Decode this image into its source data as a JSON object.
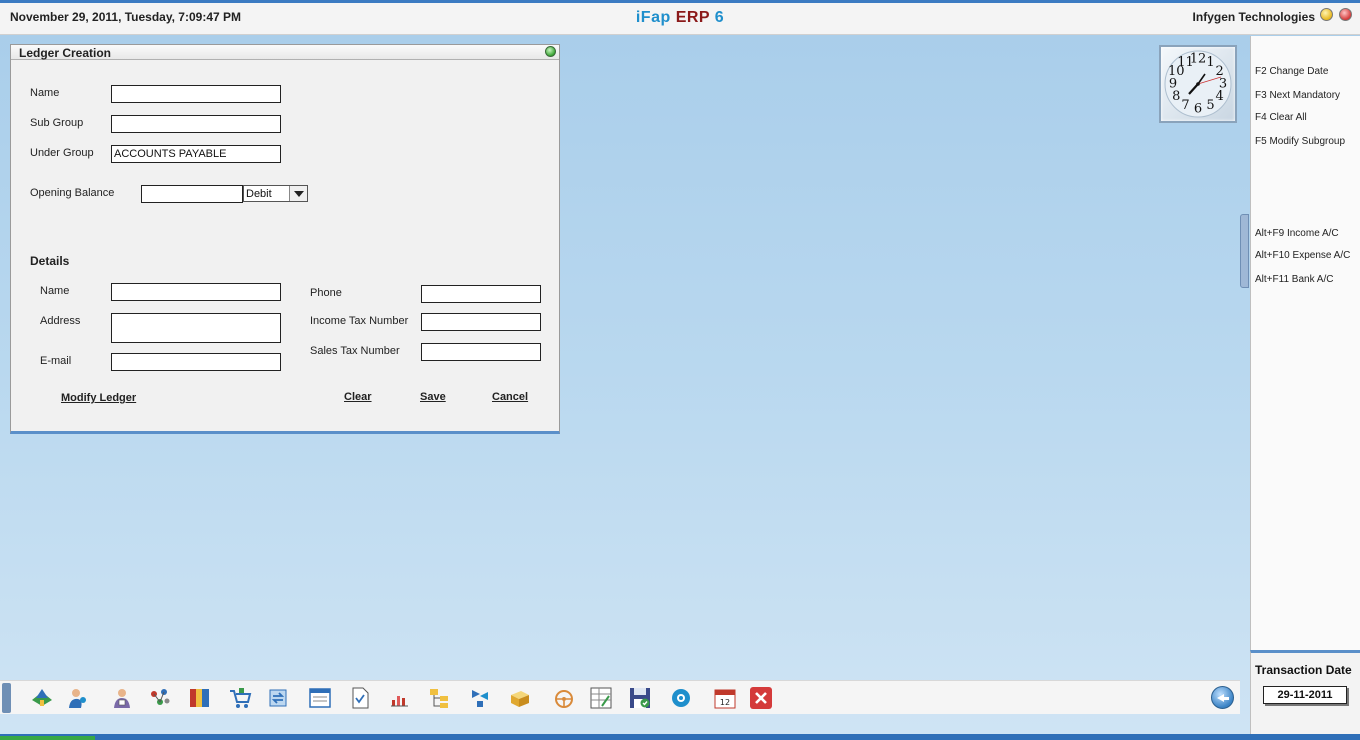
{
  "header": {
    "datetime": "November  29, 2011, Tuesday, 7:09:47 PM",
    "brand_part1": "iFap",
    "brand_part2": "ERP",
    "brand_part3": "6",
    "company": "Infygen Technologies"
  },
  "ledger": {
    "title": "Ledger Creation",
    "name_label": "Name",
    "name_value": "",
    "subgroup_label": "Sub Group",
    "subgroup_value": "",
    "undergroup_label": "Under Group",
    "undergroup_value": "ACCOUNTS PAYABLE",
    "opening_balance_label": "Opening Balance",
    "opening_balance_value": "",
    "balance_type": "Debit",
    "details_heading": "Details",
    "details_name_label": "Name",
    "details_name_value": "",
    "address_label": "Address",
    "address_value": "",
    "email_label": "E-mail",
    "email_value": "",
    "phone_label": "Phone",
    "phone_value": "",
    "income_tax_label": "Income Tax Number",
    "income_tax_value": "",
    "sales_tax_label": "Sales Tax Number",
    "sales_tax_value": "",
    "modify_button": "Modify Ledger",
    "clear_button": "Clear",
    "save_button": "Save",
    "cancel_button": "Cancel"
  },
  "shortcuts": [
    "F2 Change Date",
    "F3 Next Mandatory",
    "F4 Clear All",
    "F5 Modify Subgroup",
    "Alt+F9 Income A/C",
    "Alt+F10 Expense A/C",
    "Alt+F11 Bank A/C"
  ],
  "transaction": {
    "label": "Transaction Date",
    "date": "29-11-2011"
  },
  "clock": {
    "numerals": [
      "12",
      "1",
      "2",
      "3",
      "4",
      "5",
      "6",
      "7",
      "8",
      "9",
      "10",
      "11"
    ],
    "time": "7:09:47"
  },
  "toolbar": {
    "icons": [
      "company-icon",
      "user-icon",
      "accountant-icon",
      "network-icon",
      "books-icon",
      "cart-icon",
      "transfer-icon",
      "window-icon",
      "document-icon",
      "chart-icon",
      "folder-tree-icon",
      "workflow-icon",
      "package-icon",
      "steering-icon",
      "calculator-sheet-icon",
      "save-disk-icon",
      "settings-icon",
      "calendar-icon",
      "exit-icon"
    ],
    "calendar_day": "12"
  },
  "colors": {
    "brand_blue": "#1f8fcc",
    "brand_red": "#8b1a1a",
    "panel_border": "#5a8fc9"
  }
}
